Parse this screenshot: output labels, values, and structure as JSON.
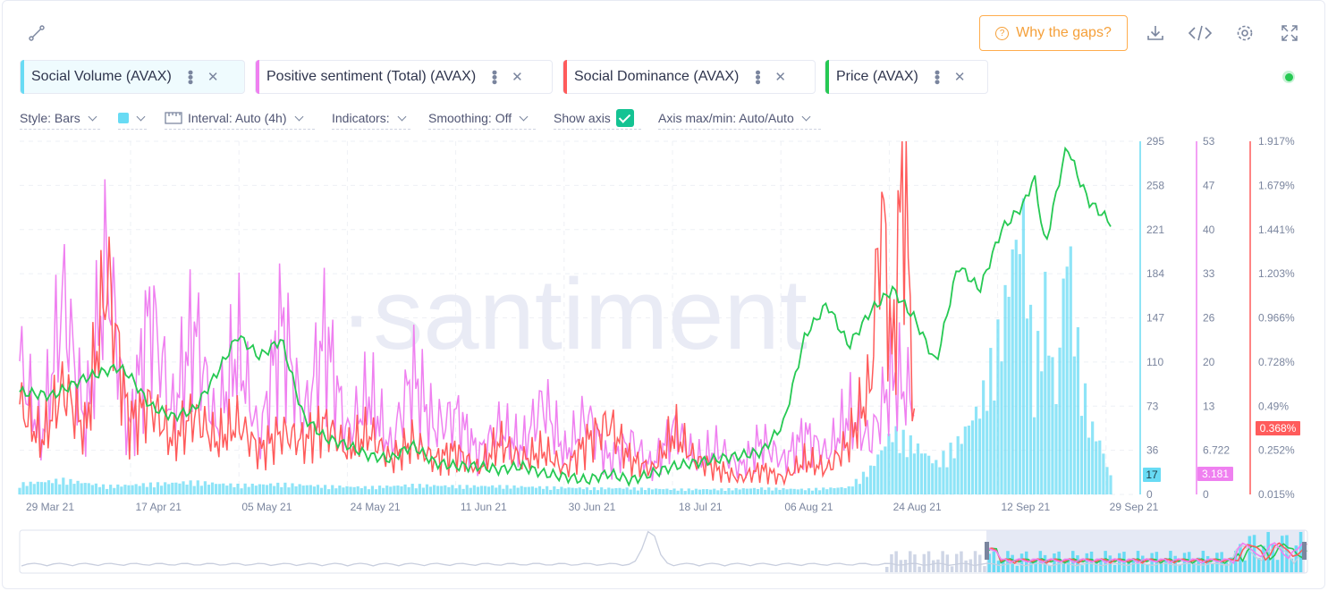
{
  "toolbar": {
    "why_gaps_label": "Why the gaps?",
    "icons": [
      "connect-icon",
      "download-icon",
      "embed-code-icon",
      "settings-gear-icon",
      "fullscreen-icon"
    ]
  },
  "metrics": [
    {
      "label": "Social Volume (AVAX)",
      "color": "#68dbf4"
    },
    {
      "label": "Positive sentiment (Total) (AVAX)",
      "color": "#ef80f0"
    },
    {
      "label": "Social Dominance (AVAX)",
      "color": "#ff5b5b"
    },
    {
      "label": "Price (AVAX)",
      "color": "#26c953"
    }
  ],
  "settings": {
    "style": "Style: Bars",
    "interval": "Interval: Auto (4h)",
    "indicators": "Indicators:",
    "smoothing": "Smoothing: Off",
    "show_axis": "Show axis",
    "axis_maxmin": "Axis max/min: Auto/Auto"
  },
  "watermark": "·santiment",
  "chart_data": {
    "type": "line",
    "x_ticks": [
      "29 Mar 21",
      "17 Apr 21",
      "05 May 21",
      "24 May 21",
      "11 Jun 21",
      "30 Jun 21",
      "18 Jul 21",
      "06 Aug 21",
      "24 Aug 21",
      "12 Sep 21",
      "29 Sep 21"
    ],
    "axes": {
      "social_volume": {
        "ticks": [
          "295",
          "258",
          "221",
          "184",
          "147",
          "110",
          "73",
          "36",
          "0"
        ],
        "range": [
          0,
          295
        ],
        "current": "17",
        "color": "#68dbf4"
      },
      "positive_sentiment": {
        "ticks": [
          "53",
          "47",
          "40",
          "33",
          "26",
          "20",
          "13",
          "6.722",
          "0"
        ],
        "range": [
          0,
          53
        ],
        "current": "3.181",
        "color": "#ef80f0"
      },
      "social_dominance": {
        "ticks": [
          "1.917%",
          "1.679%",
          "1.441%",
          "1.203%",
          "0.966%",
          "0.728%",
          "0.49%",
          "0.252%",
          "0.015%"
        ],
        "range": [
          0.015,
          1.917
        ],
        "current": "0.368%",
        "color": "#ff5b5b"
      }
    },
    "series": [
      {
        "name": "Social Volume (AVAX)",
        "style": "bars",
        "color": "#68dbf4",
        "x": [
          0,
          0.04,
          0.08,
          0.12,
          0.16,
          0.2,
          0.24,
          0.28,
          0.32,
          0.36,
          0.4,
          0.44,
          0.48,
          0.52,
          0.56,
          0.6,
          0.64,
          0.68,
          0.72,
          0.76,
          0.78,
          0.8,
          0.82,
          0.84,
          0.86,
          0.88,
          0.9,
          0.91,
          0.92,
          0.93,
          0.94,
          0.95,
          0.96,
          0.97,
          0.98,
          0.99,
          1.0
        ],
        "values": [
          10,
          14,
          8,
          10,
          12,
          9,
          10,
          8,
          7,
          9,
          8,
          8,
          7,
          6,
          6,
          5,
          5,
          6,
          5,
          7,
          25,
          60,
          48,
          30,
          50,
          85,
          160,
          230,
          260,
          110,
          190,
          90,
          250,
          140,
          70,
          50,
          17
        ]
      },
      {
        "name": "Positive sentiment (Total) (AVAX)",
        "color": "#ef80f0",
        "x": [
          0,
          0.02,
          0.04,
          0.06,
          0.08,
          0.1,
          0.12,
          0.14,
          0.16,
          0.18,
          0.2,
          0.22,
          0.24,
          0.26,
          0.28,
          0.3,
          0.32,
          0.34,
          0.36,
          0.38,
          0.4,
          0.42,
          0.44,
          0.46,
          0.48,
          0.5,
          0.52,
          0.54,
          0.56,
          0.58,
          0.6,
          0.62,
          0.64,
          0.66,
          0.68,
          0.7,
          0.72,
          0.74,
          0.76,
          0.78,
          0.8,
          0.82
        ],
        "values": [
          20,
          8,
          30,
          10,
          35,
          9,
          28,
          12,
          25,
          10,
          22,
          8,
          26,
          11,
          24,
          9,
          15,
          7,
          18,
          10,
          12,
          6,
          10,
          7,
          14,
          6,
          12,
          5,
          8,
          4,
          10,
          5,
          7,
          4,
          8,
          5,
          9,
          6,
          12,
          8,
          18,
          14
        ]
      },
      {
        "name": "Social Dominance (AVAX)",
        "color": "#ff5b5b",
        "x": [
          0,
          0.02,
          0.04,
          0.06,
          0.08,
          0.1,
          0.12,
          0.14,
          0.16,
          0.18,
          0.2,
          0.22,
          0.24,
          0.26,
          0.28,
          0.3,
          0.32,
          0.34,
          0.36,
          0.38,
          0.4,
          0.42,
          0.44,
          0.46,
          0.48,
          0.5,
          0.52,
          0.54,
          0.56,
          0.58,
          0.6,
          0.62,
          0.64,
          0.66,
          0.68,
          0.7,
          0.72,
          0.74,
          0.76,
          0.78,
          0.79,
          0.8,
          0.81,
          0.82
        ],
        "values": [
          0.5,
          0.3,
          0.6,
          0.35,
          1.2,
          0.4,
          0.5,
          0.3,
          0.45,
          0.3,
          0.4,
          0.25,
          0.35,
          0.3,
          0.4,
          0.25,
          0.35,
          0.2,
          0.3,
          0.2,
          0.25,
          0.15,
          0.3,
          0.2,
          0.25,
          0.15,
          0.3,
          0.4,
          0.2,
          0.15,
          0.35,
          0.2,
          0.15,
          0.1,
          0.15,
          0.1,
          0.2,
          0.15,
          0.3,
          0.6,
          1.6,
          0.7,
          1.9,
          0.4
        ]
      },
      {
        "name": "Price (AVAX)",
        "color": "#26c953",
        "x": [
          0,
          0.03,
          0.06,
          0.09,
          0.1,
          0.12,
          0.14,
          0.16,
          0.18,
          0.2,
          0.22,
          0.24,
          0.26,
          0.28,
          0.3,
          0.32,
          0.34,
          0.36,
          0.38,
          0.4,
          0.42,
          0.44,
          0.46,
          0.48,
          0.5,
          0.52,
          0.54,
          0.56,
          0.58,
          0.6,
          0.62,
          0.64,
          0.66,
          0.68,
          0.7,
          0.72,
          0.74,
          0.76,
          0.78,
          0.8,
          0.82,
          0.84,
          0.86,
          0.88,
          0.9,
          0.92,
          0.93,
          0.94,
          0.95,
          0.96,
          0.97,
          0.98,
          0.99,
          1.0
        ],
        "y_norm": [
          0.29,
          0.28,
          0.33,
          0.36,
          0.34,
          0.25,
          0.22,
          0.24,
          0.34,
          0.45,
          0.39,
          0.44,
          0.22,
          0.16,
          0.14,
          0.11,
          0.1,
          0.14,
          0.09,
          0.08,
          0.08,
          0.07,
          0.08,
          0.06,
          0.05,
          0.04,
          0.06,
          0.04,
          0.06,
          0.08,
          0.09,
          0.1,
          0.11,
          0.12,
          0.2,
          0.45,
          0.54,
          0.42,
          0.52,
          0.58,
          0.5,
          0.37,
          0.65,
          0.58,
          0.75,
          0.82,
          0.9,
          0.7,
          0.85,
          0.99,
          0.9,
          0.83,
          0.8,
          0.77
        ]
      }
    ]
  }
}
